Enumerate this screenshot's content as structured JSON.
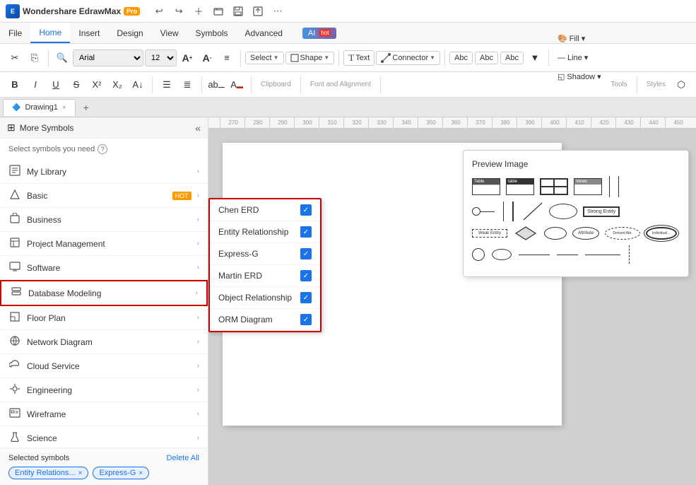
{
  "app": {
    "name": "Wondershare EdrawMax",
    "badge": "Pro"
  },
  "titlebar": {
    "undo": "↩",
    "redo": "↪",
    "new": "+",
    "open": "📁",
    "save": "💾",
    "export": "⬆",
    "more": "⋯"
  },
  "menubar": {
    "items": [
      "File",
      "Home",
      "Insert",
      "Design",
      "View",
      "Symbols",
      "Advanced"
    ],
    "active": "Home",
    "ai_label": "AI",
    "ai_hot": "hot"
  },
  "toolbar": {
    "font_name": "Arial",
    "font_size": "12",
    "select_label": "Select",
    "shape_label": "Shape",
    "text_label": "Text",
    "connector_label": "Connector",
    "fill_label": "Fill",
    "line_label": "Line",
    "shadow_label": "Shadow"
  },
  "tabs": {
    "drawing1": "Drawing1",
    "add": "+"
  },
  "ruler": {
    "marks": [
      "270",
      "280",
      "290",
      "300",
      "310",
      "320",
      "330",
      "340",
      "350",
      "360",
      "370",
      "380",
      "390",
      "400",
      "410",
      "420",
      "430",
      "440",
      "450"
    ]
  },
  "sidebar": {
    "title": "More Symbols",
    "symbols_prompt": "Select symbols you need",
    "items": [
      {
        "id": "my-library",
        "icon": "🏠",
        "label": "My Library",
        "arrow": true
      },
      {
        "id": "basic",
        "icon": "💎",
        "label": "Basic",
        "hot": true,
        "arrow": true
      },
      {
        "id": "business",
        "icon": "📊",
        "label": "Business",
        "arrow": true
      },
      {
        "id": "project-management",
        "icon": "📋",
        "label": "Project Management",
        "arrow": true
      },
      {
        "id": "software",
        "icon": "🖥",
        "label": "Software",
        "arrow": true
      },
      {
        "id": "database-modeling",
        "icon": "🗃",
        "label": "Database Modeling",
        "arrow": true,
        "active": true,
        "highlighted": true
      },
      {
        "id": "floor-plan",
        "icon": "🏢",
        "label": "Floor Plan",
        "arrow": true
      },
      {
        "id": "network-diagram",
        "icon": "🌐",
        "label": "Network Diagram",
        "arrow": true
      },
      {
        "id": "cloud-service",
        "icon": "☁",
        "label": "Cloud Service",
        "arrow": true
      },
      {
        "id": "engineering",
        "icon": "⚗",
        "label": "Engineering",
        "arrow": true
      },
      {
        "id": "wireframe",
        "icon": "🖼",
        "label": "Wireframe",
        "arrow": true
      },
      {
        "id": "science",
        "icon": "🔬",
        "label": "Science",
        "arrow": true
      }
    ]
  },
  "submenu": {
    "items": [
      {
        "id": "chen-erd",
        "label": "Chen ERD",
        "checked": true
      },
      {
        "id": "entity-relationship",
        "label": "Entity Relationship",
        "checked": true
      },
      {
        "id": "express-g",
        "label": "Express-G",
        "checked": true
      },
      {
        "id": "martin-erd",
        "label": "Martin ERD",
        "checked": true
      },
      {
        "id": "object-relationship",
        "label": "Object Relationship",
        "checked": true
      },
      {
        "id": "orm-diagram",
        "label": "ORM Diagram",
        "checked": true
      }
    ]
  },
  "selected": {
    "title": "Selected symbols",
    "delete_all": "Delete All",
    "tags": [
      {
        "id": "entity-relations",
        "label": "Entity Relations..."
      },
      {
        "id": "express-g",
        "label": "Express-G"
      }
    ]
  },
  "preview": {
    "title": "Preview Image"
  },
  "styles": {
    "accent": "#1a73e8",
    "highlight_border": "#cc0000"
  }
}
